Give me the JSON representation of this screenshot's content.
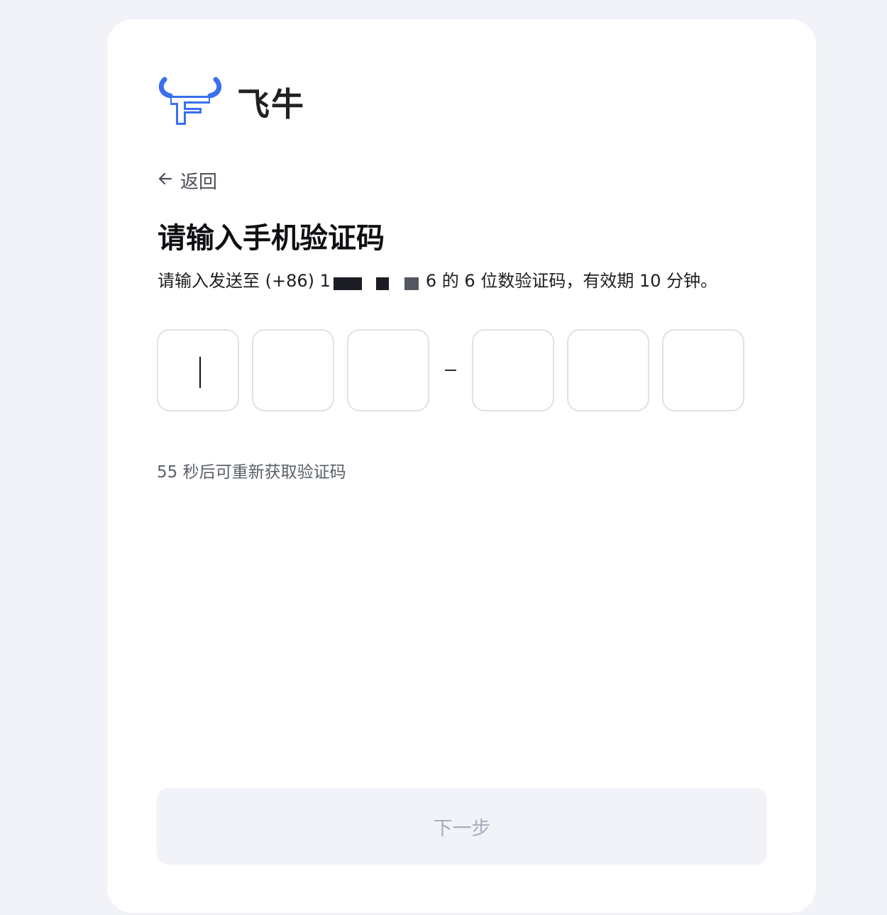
{
  "brand": {
    "name": "飞牛",
    "logo_icon": "bull-logo-icon",
    "logo_color": "#3a6ff0"
  },
  "back": {
    "icon": "arrow-left-icon",
    "label": "返回"
  },
  "title": "请输入手机验证码",
  "subtitle": {
    "prefix": "请输入发送至 (+86) 1",
    "suffix": "6 的 6 位数验证码，有效期 10 分钟。"
  },
  "code_inputs": {
    "count": 6,
    "separator": "–"
  },
  "countdown": "55 秒后可重新获取验证码",
  "next_button": {
    "label": "下一步",
    "disabled": true
  },
  "colors": {
    "page_bg": "#f1f3f8",
    "card_bg": "#ffffff",
    "accent": "#3a6ff0",
    "disabled_text": "#a7adbb"
  }
}
